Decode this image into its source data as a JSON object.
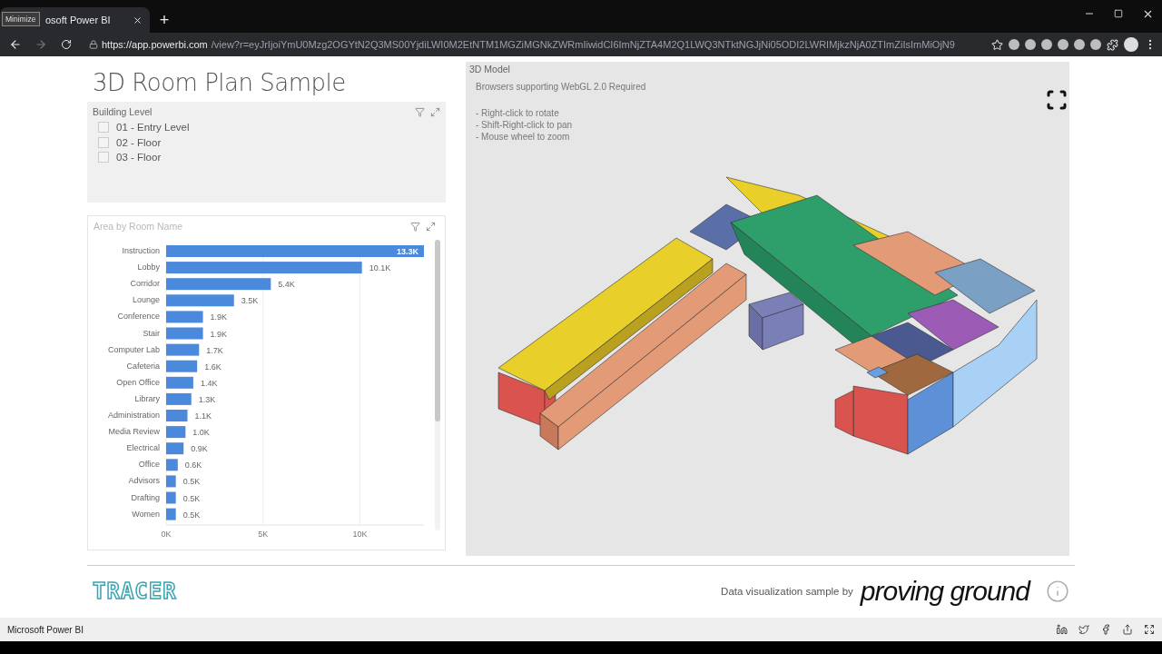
{
  "browser": {
    "tooltip": "Minimize",
    "tab_title": "osoft Power BI",
    "new_tab": "+",
    "url_host": "https://app.powerbi.com",
    "url_path": "/view?r=eyJrIjoiYmU0Mzg2OGYtN2Q3MS00YjdiLWI0M2EtNTM1MGZiMGNkZWRmIiwidCI6ImNjZTA4M2Q1LWQ3NTktNGJjNi05ODI2LWRIMjkzNjA0ZTImZiIsImMiOjN9"
  },
  "report": {
    "title": "3D Room Plan Sample"
  },
  "slicer": {
    "title": "Building Level",
    "items": [
      {
        "label": "01 - Entry Level",
        "checked": false
      },
      {
        "label": "02 - Floor",
        "checked": false
      },
      {
        "label": "03 - Floor",
        "checked": false
      }
    ]
  },
  "area_chart": {
    "title": "Area by Room Name",
    "chart_data": {
      "type": "bar",
      "orientation": "horizontal",
      "categories": [
        "Instruction",
        "Lobby",
        "Corridor",
        "Lounge",
        "Conference",
        "Stair",
        "Computer Lab",
        "Cafeteria",
        "Open Office",
        "Library",
        "Administration",
        "Media Review",
        "Electrical",
        "Office",
        "Advisors",
        "Drafting",
        "Women"
      ],
      "series": [
        {
          "color": "#4a89dc",
          "values": [
            13300,
            10100,
            5400,
            3500,
            1900,
            1900,
            1700,
            1600,
            1400,
            1300,
            1100,
            1000,
            900,
            600,
            500,
            500,
            500
          ]
        }
      ],
      "value_labels": [
        "13.3K",
        "10.1K",
        "5.4K",
        "3.5K",
        "1.9K",
        "1.9K",
        "1.7K",
        "1.6K",
        "1.4K",
        "1.3K",
        "1.1K",
        "1.0K",
        "0.9K",
        "0.6K",
        "0.5K",
        "0.5K",
        "0.5K"
      ],
      "xlim": [
        0,
        13300
      ],
      "xticks": [
        {
          "value": 0,
          "label": "0K"
        },
        {
          "value": 5000,
          "label": "5K"
        },
        {
          "value": 10000,
          "label": "10K"
        }
      ]
    }
  },
  "model": {
    "title": "3D Model",
    "notes": [
      "Browsers supporting WebGL 2.0 Required",
      "- Right-click to rotate",
      "- Shift-Right-click to pan",
      "- Mouse wheel to zoom"
    ]
  },
  "footer": {
    "brand": "TRACER",
    "credit": "Data visualization sample by",
    "credit_brand": "proving ground"
  },
  "status_bar": {
    "label": "Microsoft Power BI"
  }
}
